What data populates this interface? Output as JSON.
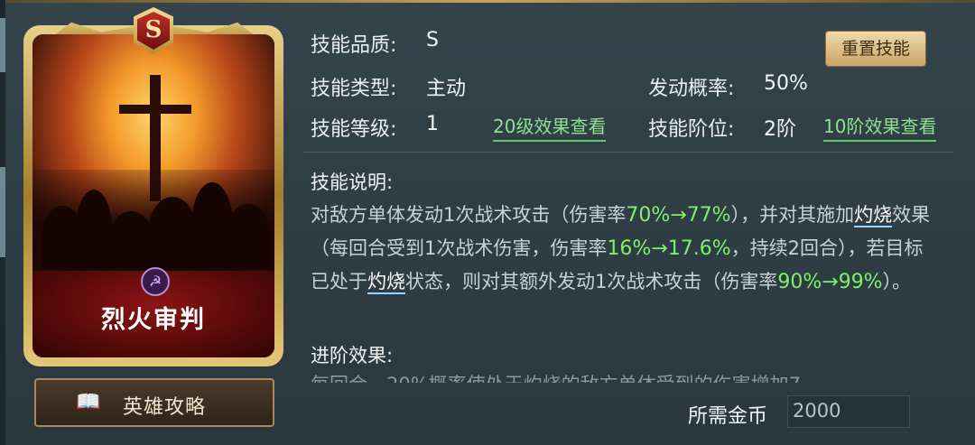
{
  "card": {
    "grade": "S",
    "name": "烈火审判"
  },
  "guide_button": {
    "label": "英雄攻略",
    "icon": "book-icon"
  },
  "reset_button": {
    "label": "重置技能"
  },
  "info": {
    "quality_label": "技能品质:",
    "quality_value": "S",
    "type_label": "技能类型:",
    "type_value": "主动",
    "chance_label": "发动概率:",
    "chance_value": "50%",
    "level_label": "技能等级:",
    "level_value": "1",
    "level_link": "20级效果查看",
    "tier_label": "技能阶位:",
    "tier_value": "2阶",
    "tier_link": "10阶效果查看"
  },
  "description": {
    "title": "技能说明:",
    "p1": "对敌方单体发动1次战术攻击（伤害率",
    "v1": "70%→77%",
    "p2": "），并对其施加",
    "k1": "灼烧",
    "p3": "效果（每回合受到1次战术伤害，伤害率",
    "v2": "16%→17.6%",
    "p4": "，持续2回合），若目标已处于",
    "k2": "灼烧",
    "p5": "状态，则对其额外发动1次战术攻击（伤害率",
    "v3": "90%→99%",
    "p6": "）。"
  },
  "advance": {
    "title": "进阶效果:",
    "partial_text": "每回合，20%概率使处于灼烧的敌方单体受到的伤害增加7"
  },
  "cost": {
    "label": "所需金币",
    "value": "2000"
  },
  "colors": {
    "highlight": "#7ff06a",
    "link": "#8fe08f",
    "accent_gold": "#c9a55a"
  }
}
